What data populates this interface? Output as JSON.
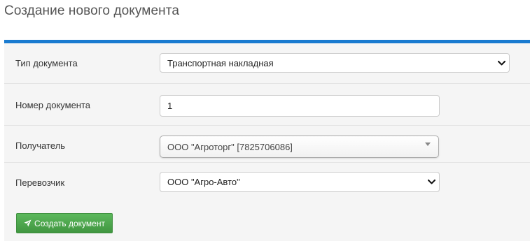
{
  "page": {
    "title": "Создание нового документа"
  },
  "form": {
    "doc_type": {
      "label": "Тип документа",
      "value": "Транспортная накладная"
    },
    "doc_number": {
      "label": "Номер документа",
      "value": "1"
    },
    "recipient": {
      "label": "Получатель",
      "value": "ООО \"Агроторг\" [7825706086]"
    },
    "carrier": {
      "label": "Перевозчик",
      "value": "ООО \"Агро-Авто\""
    },
    "submit_label": "Создать документ"
  },
  "icons": {
    "submit": "paper-plane-icon",
    "select_arrow": "chevron-down-icon",
    "chosen_arrow": "caret-down-icon"
  },
  "colors": {
    "accent": "#1a7bd0",
    "submit_button": "#4cae4c",
    "panel_background": "#f5f5f5"
  }
}
